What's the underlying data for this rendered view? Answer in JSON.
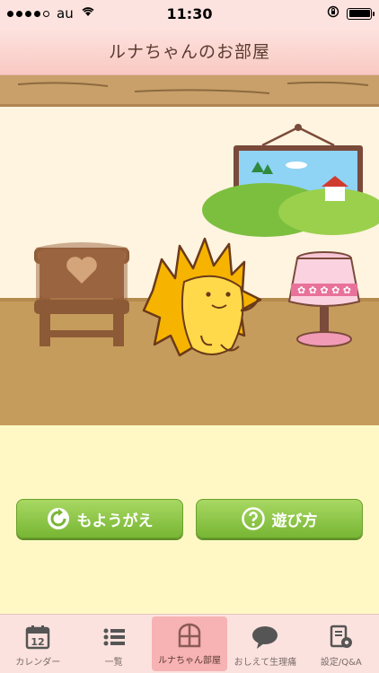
{
  "status_bar": {
    "carrier": "au",
    "time": "11:30",
    "signal_bars": 4,
    "signal_total": 5,
    "battery_level": 1.0
  },
  "nav": {
    "title": "ルナちゃんのお部屋"
  },
  "buttons": {
    "change_label": "もようがえ",
    "howto_label": "遊び方"
  },
  "tabs": [
    {
      "label": "カレンダー",
      "icon": "calendar-icon",
      "icon_text": "12"
    },
    {
      "label": "一覧",
      "icon": "list-icon"
    },
    {
      "label": "ルナちゃん部屋",
      "icon": "window-icon",
      "active": true
    },
    {
      "label": "おしえて生理痛",
      "icon": "speech-bubble-icon"
    },
    {
      "label": "設定/Q&A",
      "icon": "settings-doc-icon"
    }
  ],
  "colors": {
    "accent_green": "#8cc63f",
    "tab_active": "#f7b2b3",
    "header_pink": "#fde3df",
    "floor_brown": "#c69c5d",
    "wall_cream": "#fff4df"
  }
}
